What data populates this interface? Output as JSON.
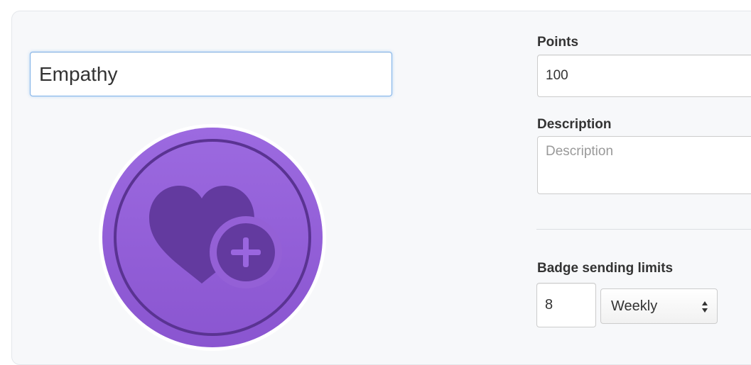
{
  "badge_editor": {
    "name_value": "Empathy",
    "badge_icon": "heart-plus-icon",
    "badge_color": "#9460d6",
    "points": {
      "label": "Points",
      "value": "100"
    },
    "description": {
      "label": "Description",
      "placeholder": "Description",
      "value": ""
    },
    "sending_limits": {
      "label": "Badge sending limits",
      "count_value": "8",
      "period_selected": "Weekly"
    }
  },
  "colors": {
    "focus_border": "#7fb1e8",
    "badge_light": "#9a66df",
    "badge_dark": "#5e3799"
  }
}
